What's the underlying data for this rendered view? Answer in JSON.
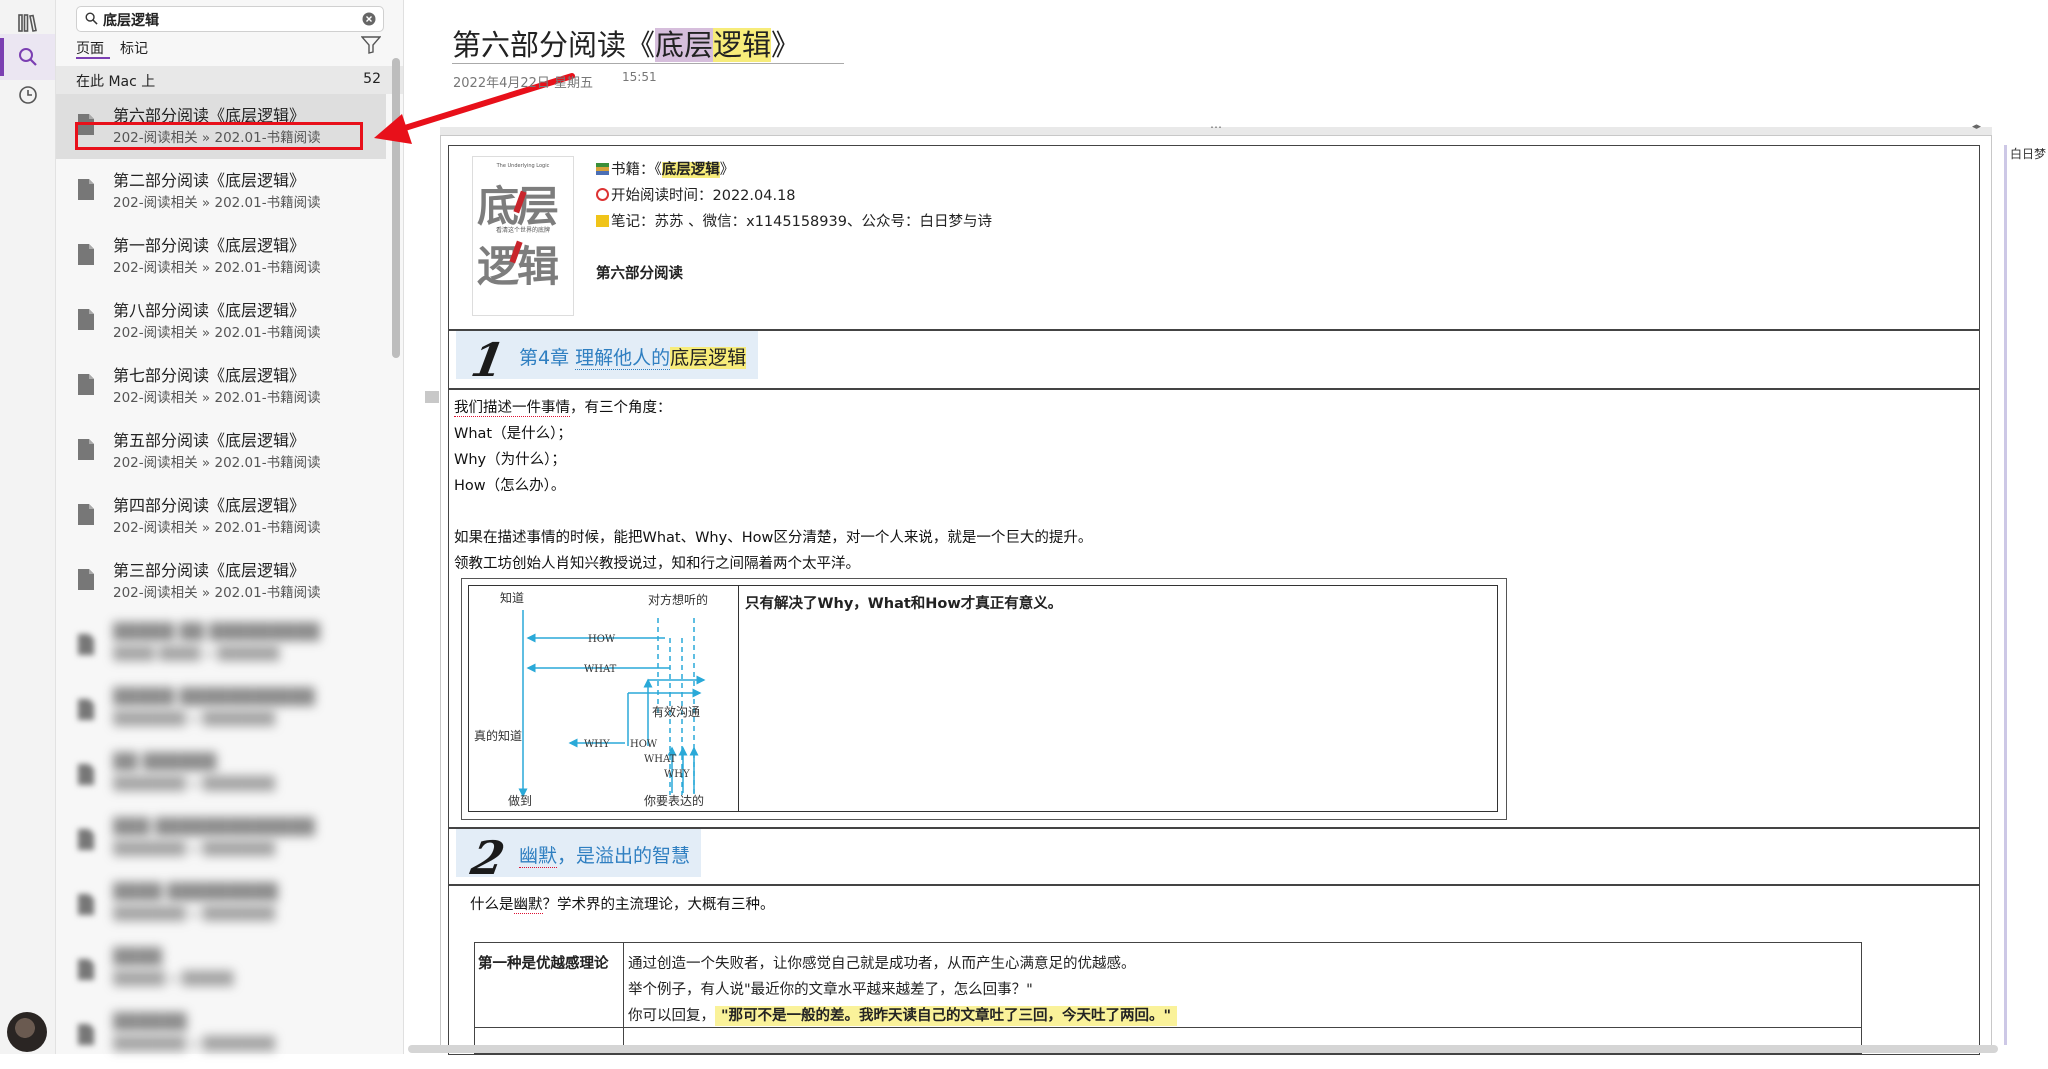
{
  "search": {
    "query": "底层逻辑",
    "tabs": [
      "页面",
      "标记"
    ],
    "scope_label": "在此 Mac 上",
    "scope_count": "52"
  },
  "results": [
    {
      "title": "第六部分阅读《底层逻辑》",
      "path": "202-阅读相关 » 202.01-书籍阅读",
      "selected": true
    },
    {
      "title": "第二部分阅读《底层逻辑》",
      "path": "202-阅读相关 » 202.01-书籍阅读"
    },
    {
      "title": "第一部分阅读《底层逻辑》",
      "path": "202-阅读相关 » 202.01-书籍阅读"
    },
    {
      "title": "第八部分阅读《底层逻辑》",
      "path": "202-阅读相关 » 202.01-书籍阅读"
    },
    {
      "title": "第七部分阅读《底层逻辑》",
      "path": "202-阅读相关 » 202.01-书籍阅读"
    },
    {
      "title": "第五部分阅读《底层逻辑》",
      "path": "202-阅读相关 » 202.01-书籍阅读"
    },
    {
      "title": "第四部分阅读《底层逻辑》",
      "path": "202-阅读相关 » 202.01-书籍阅读"
    },
    {
      "title": "第三部分阅读《底层逻辑》",
      "path": "202-阅读相关 » 202.01-书籍阅读"
    },
    {
      "title": "▒▒▒▒▒ ▒▒ ▒▒▒▒▒▒▒▒▒",
      "path": "▒▒▒▒ ▒▒▒▒ » ▒▒▒▒▒▒",
      "blurred": true
    },
    {
      "title": "▒▒▒▒▒ ▒▒▒▒▒▒▒▒▒▒▒",
      "path": "▒▒▒▒▒▒▒ » ▒▒▒▒▒▒▒",
      "blurred": true
    },
    {
      "title": "▒▒ ▒▒▒▒▒▒",
      "path": "▒▒▒▒▒▒▒ » ▒▒▒▒▒▒▒",
      "blurred": true
    },
    {
      "title": "▒▒▒ ▒▒▒▒▒▒▒▒▒▒▒▒▒",
      "path": "▒▒▒▒▒▒▒ » ▒▒▒▒▒▒▒",
      "blurred": true
    },
    {
      "title": "▒▒▒▒ ▒▒▒▒▒▒▒▒▒",
      "path": "▒▒▒▒▒▒▒ » ▒▒▒▒▒▒▒",
      "blurred": true
    },
    {
      "title": "▒▒▒▒",
      "path": "▒▒▒▒▒ » ▒▒▒▒▒",
      "blurred": true
    },
    {
      "title": "▒▒▒▒▒▒",
      "path": "▒▒▒▒▒▒▒ » ▒▒▒▒▒▒▒",
      "blurred": true
    }
  ],
  "page": {
    "title_prefix": "第六部分阅读《",
    "title_hl1": "底层",
    "title_hl2": "逻辑",
    "title_suffix": "》",
    "date": "2022年4月22日 星期五",
    "time": "15:51",
    "side_text": "白日梦"
  },
  "cover": {
    "top_en": "The Underlying Logic",
    "big1": "底层",
    "big2": "逻辑",
    "sub": "看清这个世界的底牌"
  },
  "meta": {
    "book_prefix": "书籍：《",
    "book_hl": "底层逻辑",
    "book_suffix": "》",
    "start": "开始阅读时间：2022.04.18",
    "notes": "笔记：苏苏 、微信：x1145158939、公众号：白日梦与诗",
    "section": "第六部分阅读"
  },
  "chapter1": {
    "num": "1",
    "prefix": "第4章 ",
    "title_link": "理解他人的",
    "title_hl": "底层逻辑"
  },
  "body": {
    "l1_u": "我们描述一件事情",
    "l1_rest": "，有三个角度：",
    "l2": "What（是什么）；",
    "l3": "Why（为什么）；",
    "l4": "How（怎么办）。",
    "l5": "如果在描述事情的时候，能把What、Why、How区分清楚，对一个人来说，就是一个巨大的提升。",
    "l6": "领教工坊创始人肖知兴教授说过，知和行之间隔着两个太平洋。"
  },
  "diagram": {
    "note": "只有解决了Why，What和How才真正有意义。",
    "labels": [
      "知道",
      "对方想听的",
      "HOW",
      "WHAT",
      "有效沟通",
      "真的知道",
      "WHY",
      "HOW",
      "WHAT",
      "WHY",
      "做到",
      "你要表达的"
    ]
  },
  "chapter2": {
    "num": "2",
    "title_u": "幽默",
    "title_rest": "，是溢出的智慧"
  },
  "humor": {
    "intro_prefix": "什么是",
    "intro_u": "幽默",
    "intro_rest": "？学术界的主流理论，大概有三种。",
    "label": "第一种是优越感理论",
    "l1": "通过创造一个失败者，让你感觉自己就是成功者，从而产生心满意足的优越感。",
    "l2": "举个例子，有人说\"最近你的文章水平越来越差了，怎么回事？\"",
    "l3_prefix": "你可以回复，",
    "l3_hl": "\"那可不是一般的差。我昨天读自己的文章吐了三回，今天吐了两回。\""
  }
}
